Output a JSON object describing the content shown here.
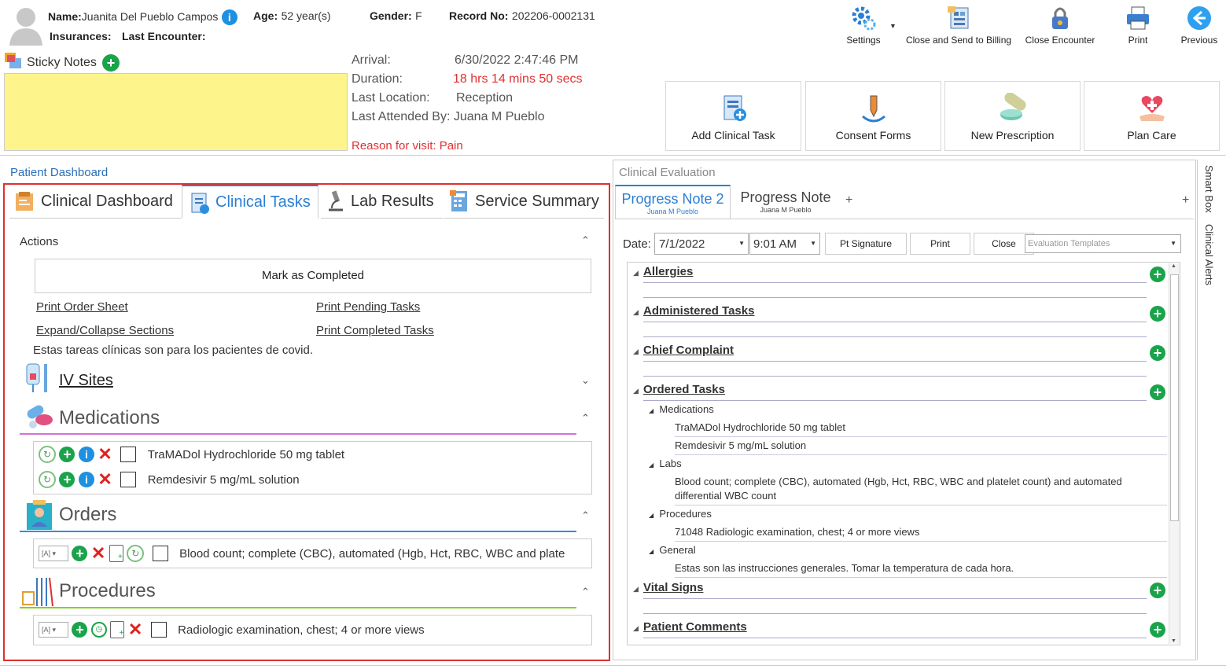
{
  "patient": {
    "name_label": "Name:",
    "name": "Juanita Del Pueblo Campos",
    "age_label": "Age:",
    "age": "52 year(s)",
    "gender_label": "Gender:",
    "gender": "F",
    "record_label": "Record No:",
    "record": "202206-0002131",
    "insurances_label": "Insurances:",
    "last_encounter_label": "Last Encounter:"
  },
  "toolbar": {
    "settings": "Settings",
    "close_send_billing": "Close and Send to Billing",
    "close_encounter": "Close Encounter",
    "print": "Print",
    "previous": "Previous"
  },
  "sticky_notes": {
    "label": "Sticky Notes",
    "note_color": "#fdf58c"
  },
  "encounter": {
    "arrival_label": "Arrival:",
    "arrival": "6/30/2022 2:47:46 PM",
    "duration_label": "Duration:",
    "duration": "18 hrs 14 mins 50 secs",
    "last_location_label": "Last Location:",
    "last_location": "Reception",
    "last_attended_label": "Last Attended By:",
    "last_attended": "Juana M Pueblo",
    "reason": "Reason for visit: Pain"
  },
  "quick_actions": {
    "add_clinical_task": "Add Clinical Task",
    "consent_forms": "Consent Forms",
    "new_prescription": "New Prescription",
    "plan_care": "Plan Care"
  },
  "dashboard": {
    "title": "Patient Dashboard",
    "tabs": [
      "Clinical Dashboard",
      "Clinical Tasks",
      "Lab Results",
      "Service Summary"
    ],
    "active_tab": "Clinical Tasks"
  },
  "actions": {
    "title": "Actions",
    "mark_completed": "Mark as Completed",
    "print_order_sheet": "Print Order Sheet",
    "print_pending": "Print Pending Tasks",
    "expand_collapse": "Expand/Collapse Sections",
    "print_completed": "Print Completed Tasks",
    "note": "Estas tareas clínicas son para los pacientes de covid."
  },
  "sections": {
    "iv_sites": "IV Sites",
    "medications": "Medications",
    "medications_color": "#d66fd6",
    "orders": "Orders",
    "orders_color": "#2e8fe0",
    "procedures": "Procedures",
    "procedures_color": "#7ed321"
  },
  "medications": [
    "TraMADol Hydrochloride 50 mg tablet",
    "Remdesivir 5 mg/mL solution"
  ],
  "orders": [
    "Blood count; complete (CBC), automated (Hgb, Hct, RBC, WBC and plate"
  ],
  "procedures": [
    "Radiologic examination, chest; 4 or more views"
  ],
  "evaluation": {
    "title": "Clinical Evaluation",
    "tabs": [
      {
        "label": "Progress Note 2",
        "author": "Juana M Pueblo"
      },
      {
        "label": "Progress Note",
        "author": "Juana M Pueblo"
      }
    ],
    "add_tab": "+",
    "date_label": "Date:",
    "date": "7/1/2022",
    "time": "9:01 AM",
    "pt_signature": "Pt Signature",
    "print": "Print",
    "close": "Close",
    "templates_placeholder": "Evaluation Templates",
    "sections": [
      "Allergies",
      "Administered Tasks",
      "Chief Complaint",
      "Ordered Tasks",
      "Vital Signs",
      "Patient Comments"
    ],
    "ordered": {
      "medications_label": "Medications",
      "medications": [
        "TraMADol Hydrochloride 50 mg tablet",
        "Remdesivir 5 mg/mL solution"
      ],
      "labs_label": "Labs",
      "labs": [
        "Blood count; complete (CBC), automated (Hgb, Hct, RBC, WBC and platelet count) and automated differential WBC count"
      ],
      "procedures_label": "Procedures",
      "procedures": [
        "71048 Radiologic examination, chest; 4 or more views"
      ],
      "general_label": "General",
      "general": [
        "Estas son las instrucciones generales. Tomar la temperatura de cada hora."
      ]
    }
  },
  "side_tabs": {
    "smart_box": "Smart Box",
    "clinical_alerts": "Clinical Alerts"
  }
}
